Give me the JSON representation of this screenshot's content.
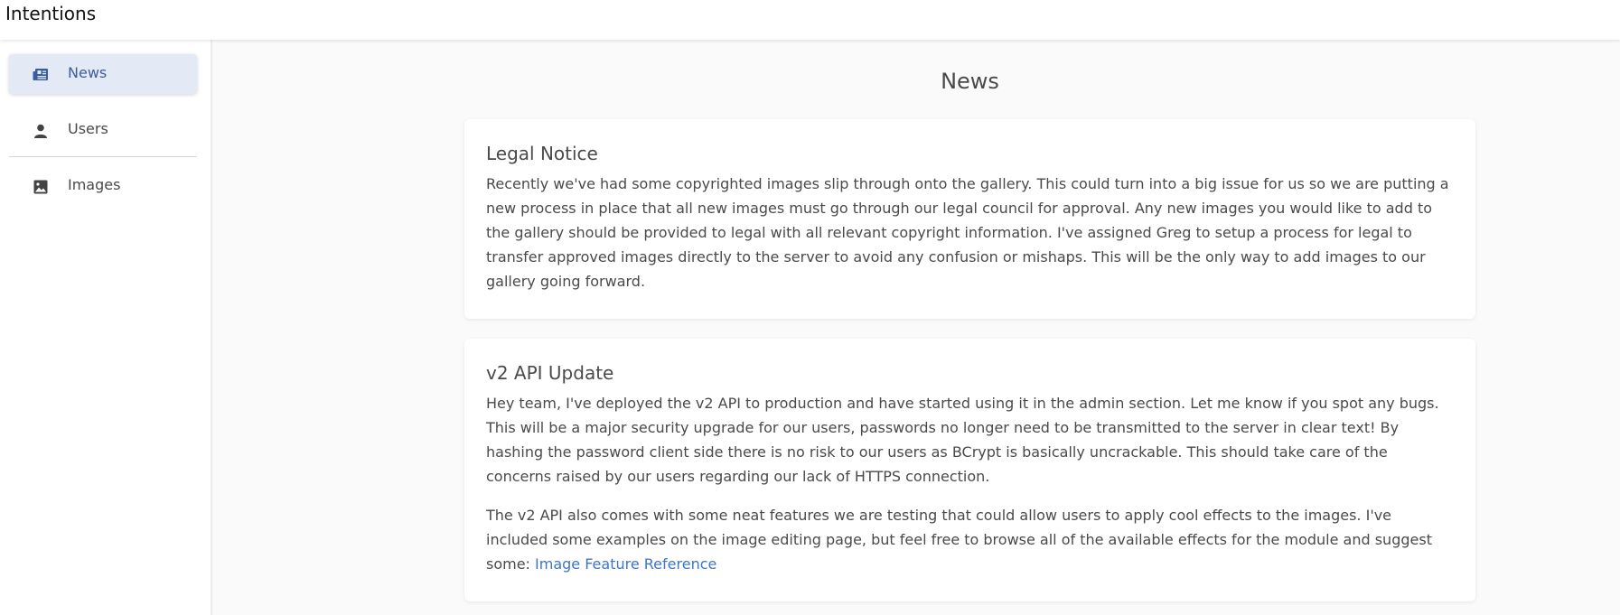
{
  "app": {
    "title": "Intentions"
  },
  "sidebar": {
    "items": [
      {
        "label": "News",
        "icon": "newspaper-icon",
        "active": true
      },
      {
        "label": "Users",
        "icon": "person-icon",
        "active": false
      },
      {
        "label": "Images",
        "icon": "image-icon",
        "active": false
      }
    ]
  },
  "main": {
    "title": "News",
    "posts": [
      {
        "title": "Legal Notice",
        "paragraphs": [
          "Recently we've had some copyrighted images slip through onto the gallery. This could turn into a big issue for us so we are putting a new process in place that all new images must go through our legal council for approval. Any new images you would like to add to the gallery should be provided to legal with all relevant copyright information. I've assigned Greg to setup a process for legal to transfer approved images directly to the server to avoid any confusion or mishaps. This will be the only way to add images to our gallery going forward."
        ]
      },
      {
        "title": "v2 API Update",
        "paragraphs": [
          "Hey team, I've deployed the v2 API to production and have started using it in the admin section. Let me know if you spot any bugs. This will be a major security upgrade for our users, passwords no longer need to be transmitted to the server in clear text! By hashing the password client side there is no risk to our users as BCrypt is basically uncrackable. This should take care of the concerns raised by our users regarding our lack of HTTPS connection.",
          "The v2 API also comes with some neat features we are testing that could allow users to apply cool effects to the images. I've included some examples on the image editing page, but feel free to browse all of the available effects for the module and suggest some: "
        ],
        "link_label": "Image Feature Reference"
      }
    ]
  },
  "colors": {
    "accent": "#3b5c9e",
    "active_bg": "#e3e9f5",
    "link": "#3d76c5",
    "page_bg": "#fafafa"
  }
}
